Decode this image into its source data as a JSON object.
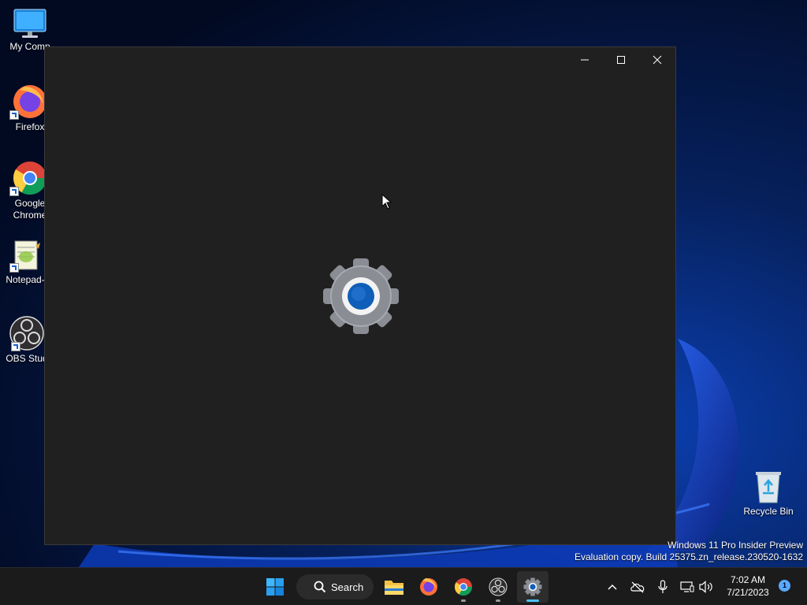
{
  "desktop": {
    "icons": [
      {
        "label": "My Comp",
        "icon": "monitor-icon"
      },
      {
        "label": "Firefox",
        "icon": "firefox-icon"
      },
      {
        "label": "Google Chrome",
        "icon": "chrome-icon"
      },
      {
        "label": "Notepad-",
        "icon": "notepad-icon"
      },
      {
        "label": "OBS Stud",
        "icon": "obs-icon"
      },
      {
        "label": "Recycle Bin",
        "icon": "recycle-bin-icon"
      }
    ],
    "watermark": {
      "line1": "Windows 11 Pro Insider Preview",
      "line2": "Evaluation copy. Build 25375.zn_release.230520-1632"
    }
  },
  "window": {
    "app": "Settings",
    "splash_icon": "settings-gear-icon",
    "controls": [
      "minimize-icon",
      "maximize-icon",
      "close-icon"
    ]
  },
  "taskbar": {
    "search_label": "Search",
    "pinned": [
      "start-icon",
      "file-explorer-icon",
      "firefox-icon",
      "chrome-icon",
      "obs-icon",
      "settings-icon"
    ],
    "tray": [
      "chevron-up-icon",
      "onedrive-icon",
      "microphone-icon",
      "network-icon",
      "volume-icon"
    ],
    "time": "7:02 AM",
    "date": "7/21/2023",
    "notification_count": "1"
  },
  "colors": {
    "window_bg": "#202020",
    "taskbar_bg": "#1b1b1b",
    "accent": "#4cc2ff",
    "desktop_bg": "#061a44"
  }
}
